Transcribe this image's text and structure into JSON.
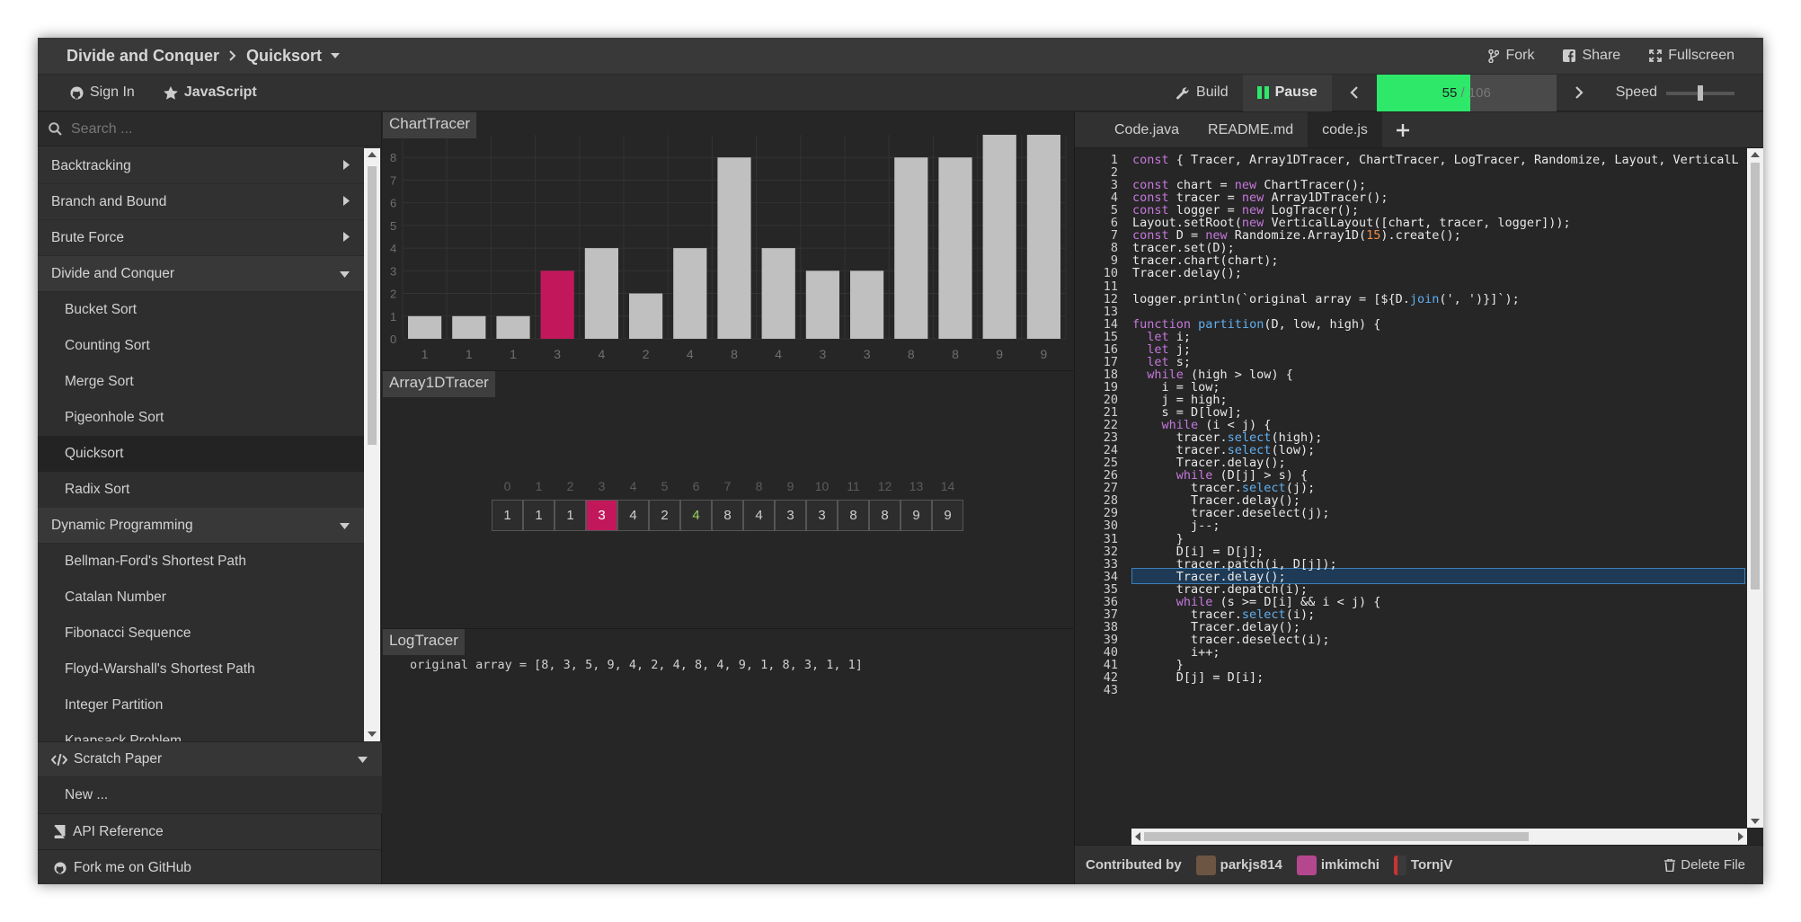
{
  "header": {
    "category": "Divide and Conquer",
    "algorithm": "Quicksort",
    "fork_label": "Fork",
    "share_label": "Share",
    "fullscreen_label": "Fullscreen"
  },
  "toolbar": {
    "sign_in_label": "Sign In",
    "language_label": "JavaScript",
    "build_label": "Build",
    "pause_label": "Pause",
    "progress_current": "55",
    "progress_sep": " / ",
    "progress_total": "106",
    "progress_fraction": 0.519,
    "speed_label": "Speed",
    "speed_fraction": 0.5
  },
  "sidebar": {
    "search_placeholder": "Search ...",
    "categories": [
      {
        "label": "Backtracking",
        "open": false
      },
      {
        "label": "Branch and Bound",
        "open": false
      },
      {
        "label": "Brute Force",
        "open": false
      },
      {
        "label": "Divide and Conquer",
        "open": true,
        "items": [
          "Bucket Sort",
          "Counting Sort",
          "Merge Sort",
          "Pigeonhole Sort",
          "Quicksort",
          "Radix Sort"
        ],
        "active": "Quicksort"
      },
      {
        "label": "Dynamic Programming",
        "open": true,
        "items": [
          "Bellman-Ford's Shortest Path",
          "Catalan Number",
          "Fibonacci Sequence",
          "Floyd-Warshall's Shortest Path",
          "Integer Partition",
          "Knapsack Problem"
        ]
      }
    ],
    "scratch_label": "Scratch Paper",
    "new_label": "New ...",
    "api_label": "API Reference",
    "github_label": "Fork me on GitHub"
  },
  "chart_panel": {
    "title": "ChartTracer"
  },
  "chart_data": {
    "type": "bar",
    "categories": [
      "1",
      "1",
      "1",
      "3",
      "4",
      "2",
      "4",
      "8",
      "4",
      "3",
      "3",
      "8",
      "8",
      "9",
      "9"
    ],
    "values": [
      1,
      1,
      1,
      3,
      4,
      2,
      4,
      8,
      4,
      3,
      3,
      8,
      8,
      9,
      9
    ],
    "highlight_index": 3,
    "ylim": [
      0,
      9
    ],
    "yticks": [
      "0",
      "1",
      "2",
      "3",
      "4",
      "5",
      "6",
      "7",
      "8"
    ],
    "grid": true,
    "colors": {
      "bar": "#c0c0c0",
      "highlight": "#c2185b"
    }
  },
  "array_panel": {
    "title": "Array1DTracer",
    "indices": [
      "0",
      "1",
      "2",
      "3",
      "4",
      "5",
      "6",
      "7",
      "8",
      "9",
      "10",
      "11",
      "12",
      "13",
      "14"
    ],
    "values": [
      "1",
      "1",
      "1",
      "3",
      "4",
      "2",
      "4",
      "8",
      "4",
      "3",
      "3",
      "8",
      "8",
      "9",
      "9"
    ],
    "selected_index": 3,
    "patched_indices": [
      6
    ]
  },
  "log_panel": {
    "title": "LogTracer",
    "line": "original array = [8, 3, 5, 9, 4, 2, 4, 8, 4, 9, 1, 8, 3, 1, 1]"
  },
  "editor": {
    "tabs": [
      "Code.java",
      "README.md",
      "code.js"
    ],
    "active_tab": "code.js",
    "highlight_line": 34,
    "lines": [
      "const { Tracer, Array1DTracer, ChartTracer, LogTracer, Randomize, Layout, VerticalL",
      "",
      "const chart = new ChartTracer();",
      "const tracer = new Array1DTracer();",
      "const logger = new LogTracer();",
      "Layout.setRoot(new VerticalLayout([chart, tracer, logger]));",
      "const D = new Randomize.Array1D(15).create();",
      "tracer.set(D);",
      "tracer.chart(chart);",
      "Tracer.delay();",
      "",
      "logger.println(`original array = [${D.join(', ')}]`);",
      "",
      "function partition(D, low, high) {",
      "  let i;",
      "  let j;",
      "  let s;",
      "  while (high > low) {",
      "    i = low;",
      "    j = high;",
      "    s = D[low];",
      "    while (i < j) {",
      "      tracer.select(high);",
      "      tracer.select(low);",
      "      Tracer.delay();",
      "      while (D[j] > s) {",
      "        tracer.select(j);",
      "        Tracer.delay();",
      "        tracer.deselect(j);",
      "        j--;",
      "      }",
      "      D[i] = D[j];",
      "      tracer.patch(i, D[j]);",
      "      Tracer.delay();",
      "      tracer.depatch(i);",
      "      while (s >= D[i] && i < j) {",
      "        tracer.select(i);",
      "        Tracer.delay();",
      "        tracer.deselect(i);",
      "        i++;",
      "      }",
      "      D[j] = D[i];",
      ""
    ]
  },
  "footer": {
    "contributed_label": "Contributed by",
    "contributors": [
      "parkjs814",
      "imkimchi",
      "TornjV"
    ],
    "delete_label": "Delete File"
  },
  "colors": {
    "accent": "#2ee86a",
    "highlight": "#c2185b"
  }
}
